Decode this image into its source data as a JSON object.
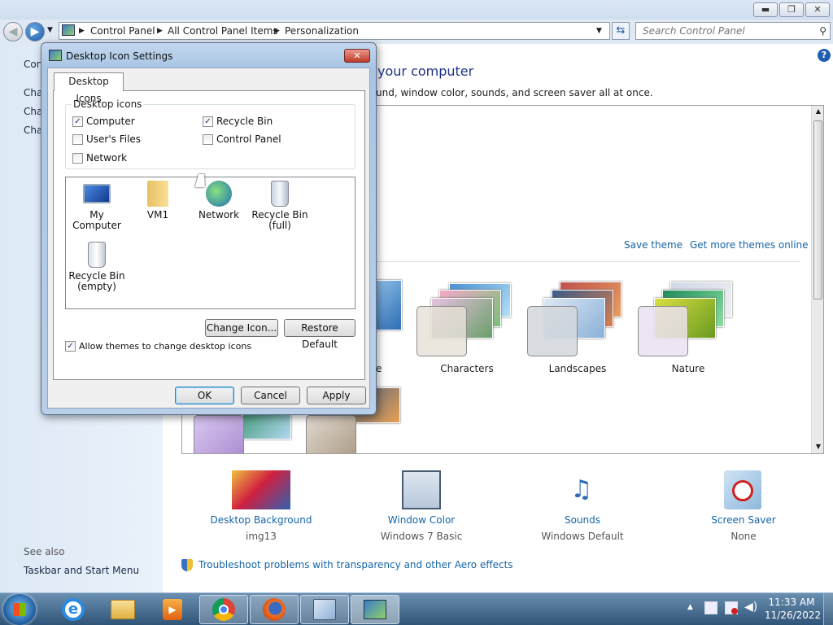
{
  "window": {
    "min_label": "▬",
    "max_label": "❐",
    "close_label": "✕"
  },
  "nav": {
    "back_icon": "◀",
    "forward_icon": "▶",
    "address_segments": [
      "Control Panel",
      "All Control Panel Items",
      "Personalization"
    ],
    "search_placeholder": "Search Control Panel"
  },
  "left_pane": {
    "items": [
      "Con",
      "Cha",
      "Cha",
      "Cha"
    ],
    "see_also_heading": "See also",
    "see_also_links": [
      "Taskbar and Start Menu"
    ]
  },
  "main": {
    "heading": "your computer",
    "subheading": "und, window color, sounds, and screen saver all at once.",
    "save_theme": "Save theme",
    "get_more_themes": "Get more themes online",
    "themes": [
      {
        "label": "e"
      },
      {
        "label": "Characters"
      },
      {
        "label": "Landscapes"
      },
      {
        "label": "Nature"
      }
    ],
    "bottom_items": [
      {
        "label": "Desktop Background",
        "sub": "img13"
      },
      {
        "label": "Window Color",
        "sub": "Windows 7 Basic"
      },
      {
        "label": "Sounds",
        "sub": "Windows Default"
      },
      {
        "label": "Screen Saver",
        "sub": "None"
      }
    ],
    "troubleshoot": "Troubleshoot problems with transparency and other Aero effects"
  },
  "dialog": {
    "title": "Desktop Icon Settings",
    "tab": "Desktop Icons",
    "group_label": "Desktop icons",
    "checkboxes": [
      {
        "label": "Computer",
        "checked": true
      },
      {
        "label": "Recycle Bin",
        "checked": true
      },
      {
        "label": "User's Files",
        "checked": false
      },
      {
        "label": "Control Panel",
        "checked": false
      },
      {
        "label": "Network",
        "checked": false
      }
    ],
    "icons": [
      {
        "label": "My Computer"
      },
      {
        "label": "VM1"
      },
      {
        "label": "Network"
      },
      {
        "label": "Recycle Bin (full)"
      },
      {
        "label": "Recycle Bin (empty)"
      }
    ],
    "change_icon": "Change Icon...",
    "restore_default": "Restore Default",
    "allow_themes": "Allow themes to change desktop icons",
    "allow_themes_checked": true,
    "ok": "OK",
    "cancel": "Cancel",
    "apply": "Apply"
  },
  "taskbar": {
    "time": "11:33 AM",
    "date": "11/26/2022"
  }
}
